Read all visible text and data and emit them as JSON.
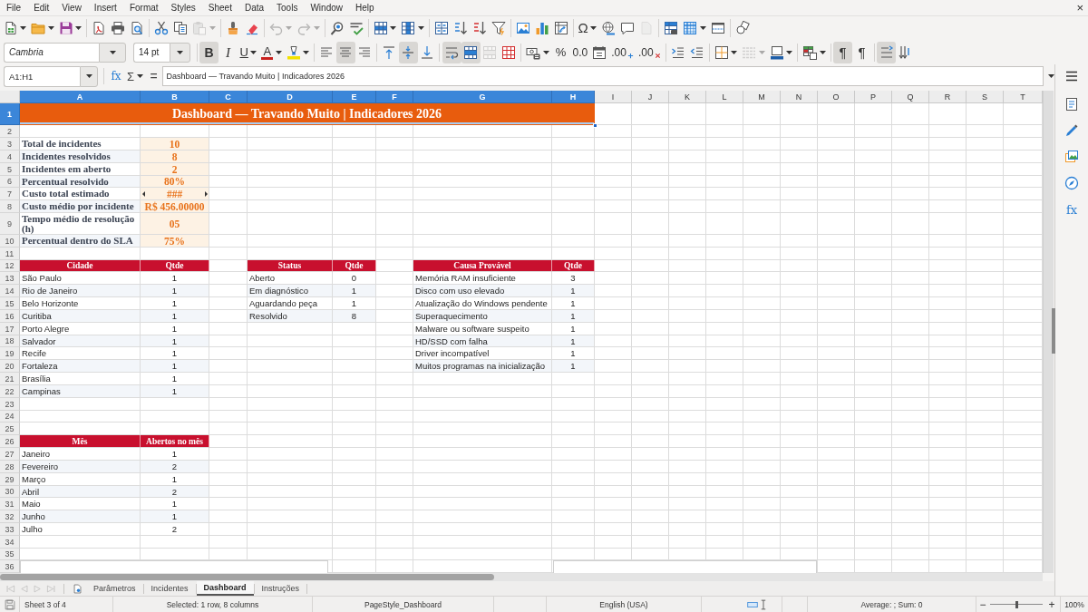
{
  "menu_bar": {
    "items": [
      "File",
      "Edit",
      "View",
      "Insert",
      "Format",
      "Styles",
      "Sheet",
      "Data",
      "Tools",
      "Window",
      "Help"
    ],
    "close_label": "×"
  },
  "standard_toolbar": [
    {
      "disabled": false
    },
    {
      "disabled": false
    },
    {
      "disabled": false
    },
    {
      "disabled": false
    },
    {
      "disabled": false
    },
    {
      "disabled": false
    },
    {
      "disabled": false
    },
    {
      "disabled": false
    },
    {
      "disabled": true
    },
    {
      "disabled": false
    },
    {
      "disabled": false
    },
    {
      "disabled": true
    },
    {
      "disabled": true
    },
    {
      "disabled": false
    },
    {
      "disabled": false
    },
    {
      "disabled": false
    },
    {
      "disabled": false
    },
    {
      "disabled": false
    },
    {
      "disabled": false
    },
    {
      "disabled": false
    },
    {
      "disabled": false
    },
    {
      "disabled": false
    },
    {
      "disabled": false
    },
    {
      "disabled": false
    },
    {
      "label": "Ω",
      "disabled": false
    },
    {
      "disabled": false
    },
    {
      "disabled": false
    },
    {
      "disabled": true
    },
    {
      "disabled": false
    },
    {
      "disabled": false
    },
    {
      "disabled": false
    },
    {
      "disabled": false
    }
  ],
  "formatting_toolbar": {
    "font_name": "Cambria",
    "font_size": "14 pt",
    "buttons": [
      {
        "label": "B",
        "pressed": true,
        "disabled": false
      },
      {
        "label": "I",
        "pressed": false,
        "disabled": false
      },
      {
        "label": "U",
        "pressed": false,
        "disabled": false
      },
      {
        "label": "A",
        "pressed": false,
        "disabled": false
      },
      {
        "pressed": false,
        "disabled": false
      },
      {
        "pressed": false,
        "disabled": false
      },
      {
        "pressed": true,
        "disabled": false
      },
      {
        "pressed": false,
        "disabled": false
      },
      {
        "pressed": false,
        "disabled": false
      },
      {
        "pressed": true,
        "disabled": false
      },
      {
        "pressed": false,
        "disabled": false
      },
      {
        "pressed": true,
        "disabled": false
      },
      {
        "pressed": true,
        "disabled": false
      },
      {
        "pressed": false,
        "disabled": true
      },
      {
        "pressed": false,
        "disabled": false
      },
      {
        "pressed": false,
        "disabled": false
      },
      {
        "label": "%",
        "pressed": false,
        "disabled": false
      },
      {
        "label": "0.0",
        "pressed": false,
        "disabled": false
      },
      {
        "pressed": false,
        "disabled": false
      },
      {
        "label": ".00",
        "pressed": false,
        "disabled": false
      },
      {
        "label": ".00",
        "pressed": false,
        "disabled": false
      },
      {
        "pressed": false,
        "disabled": false
      },
      {
        "pressed": false,
        "disabled": false
      },
      {
        "pressed": false,
        "disabled": false
      },
      {
        "pressed": false,
        "disabled": true
      },
      {
        "pressed": false,
        "disabled": false
      },
      {
        "pressed": false,
        "disabled": false
      },
      {
        "label": "¶",
        "pressed": true,
        "disabled": false
      },
      {
        "label": "¶",
        "pressed": false,
        "disabled": false
      },
      {
        "pressed": true,
        "disabled": false
      },
      {
        "pressed": false,
        "disabled": false
      }
    ]
  },
  "formula_bar": {
    "name_box": "A1:H1",
    "function_wizard": "fx",
    "sum": "Σ",
    "equals": "=",
    "content": "Dashboard — Travando Muito | Indicadores 2026"
  },
  "sheet": {
    "columns": [
      {
        "label": "A",
        "selected": true
      },
      {
        "label": "B",
        "selected": true
      },
      {
        "label": "C",
        "selected": true
      },
      {
        "label": "D",
        "selected": true
      },
      {
        "label": "E",
        "selected": true
      },
      {
        "label": "F",
        "selected": true
      },
      {
        "label": "G",
        "selected": true
      },
      {
        "label": "H",
        "selected": true
      },
      {
        "label": "I",
        "selected": false
      },
      {
        "label": "J",
        "selected": false
      },
      {
        "label": "K",
        "selected": false
      },
      {
        "label": "L",
        "selected": false
      },
      {
        "label": "M",
        "selected": false
      },
      {
        "label": "N",
        "selected": false
      },
      {
        "label": "O",
        "selected": false
      },
      {
        "label": "P",
        "selected": false
      },
      {
        "label": "Q",
        "selected": false
      },
      {
        "label": "R",
        "selected": false
      },
      {
        "label": "S",
        "selected": false
      },
      {
        "label": "T",
        "selected": false
      }
    ],
    "rows": [
      {
        "label": "1",
        "selected": true
      },
      {
        "label": "2",
        "selected": false
      },
      {
        "label": "3",
        "selected": false
      },
      {
        "label": "4",
        "selected": false
      },
      {
        "label": "5",
        "selected": false
      },
      {
        "label": "6",
        "selected": false
      },
      {
        "label": "7",
        "selected": false
      },
      {
        "label": "8",
        "selected": false
      },
      {
        "label": "9",
        "selected": false
      },
      {
        "label": "10",
        "selected": false
      },
      {
        "label": "11",
        "selected": false
      },
      {
        "label": "12",
        "selected": false
      },
      {
        "label": "13",
        "selected": false
      },
      {
        "label": "14",
        "selected": false
      },
      {
        "label": "15",
        "selected": false
      },
      {
        "label": "16",
        "selected": false
      },
      {
        "label": "17",
        "selected": false
      },
      {
        "label": "18",
        "selected": false
      },
      {
        "label": "19",
        "selected": false
      },
      {
        "label": "20",
        "selected": false
      },
      {
        "label": "21",
        "selected": false
      },
      {
        "label": "22",
        "selected": false
      },
      {
        "label": "23",
        "selected": false
      },
      {
        "label": "24",
        "selected": false
      },
      {
        "label": "25",
        "selected": false
      },
      {
        "label": "26",
        "selected": false
      },
      {
        "label": "27",
        "selected": false
      },
      {
        "label": "28",
        "selected": false
      },
      {
        "label": "29",
        "selected": false
      },
      {
        "label": "30",
        "selected": false
      },
      {
        "label": "31",
        "selected": false
      },
      {
        "label": "32",
        "selected": false
      },
      {
        "label": "33",
        "selected": false
      },
      {
        "label": "34",
        "selected": false
      },
      {
        "label": "35",
        "selected": false
      },
      {
        "label": "36",
        "selected": false
      }
    ],
    "title": {
      "text": "Dashboard — Travando Muito | Indicadores 2026",
      "selected": true
    },
    "kpis": [
      {
        "label": "Total de incidentes",
        "value": "10",
        "clipped": false
      },
      {
        "label": "Incidentes resolvidos",
        "value": "8",
        "clipped": false
      },
      {
        "label": "Incidentes em aberto",
        "value": "2",
        "clipped": false
      },
      {
        "label": "Percentual resolvido",
        "value": "80%",
        "clipped": false
      },
      {
        "label": "Custo total estimado",
        "value": "###",
        "clipped": true
      },
      {
        "label": "Custo médio por incidente",
        "value": "R$ 456.00000",
        "clipped": false
      },
      {
        "label": "Tempo médio de resolução (h)",
        "value": "05",
        "clipped": false
      },
      {
        "label": "Percentual dentro do SLA",
        "value": "75%",
        "clipped": false
      }
    ],
    "tables": [
      {
        "columns": [
          "Cidade",
          "Qtde"
        ],
        "rows": [
          [
            "São Paulo",
            "1"
          ],
          [
            "Rio de Janeiro",
            "1"
          ],
          [
            "Belo Horizonte",
            "1"
          ],
          [
            "Curitiba",
            "1"
          ],
          [
            "Porto Alegre",
            "1"
          ],
          [
            "Salvador",
            "1"
          ],
          [
            "Recife",
            "1"
          ],
          [
            "Fortaleza",
            "1"
          ],
          [
            "Brasília",
            "1"
          ],
          [
            "Campinas",
            "1"
          ]
        ]
      },
      {
        "columns": [
          "Status",
          "Qtde"
        ],
        "rows": [
          [
            "Aberto",
            "0"
          ],
          [
            "Em diagnóstico",
            "1"
          ],
          [
            "Aguardando peça",
            "1"
          ],
          [
            "Resolvido",
            "8"
          ]
        ]
      },
      {
        "columns": [
          "Causa Provável",
          "Qtde"
        ],
        "rows": [
          [
            "Memória RAM insuficiente",
            "3"
          ],
          [
            "Disco com uso elevado",
            "1"
          ],
          [
            "Atualização do Windows pendente",
            "1"
          ],
          [
            "Superaquecimento",
            "1"
          ],
          [
            "Malware ou software suspeito",
            "1"
          ],
          [
            "HD/SSD com falha",
            "1"
          ],
          [
            "Driver incompatível",
            "1"
          ],
          [
            "Muitos programas na inicialização",
            "1"
          ]
        ]
      },
      {
        "columns": [
          "Mês",
          "Abertos no mês"
        ],
        "rows": [
          [
            "Janeiro",
            "1"
          ],
          [
            "Fevereiro",
            "2"
          ],
          [
            "Março",
            "1"
          ],
          [
            "Abril",
            "2"
          ],
          [
            "Maio",
            "1"
          ],
          [
            "Junho",
            "1"
          ],
          [
            "Julho",
            "2"
          ]
        ]
      }
    ]
  },
  "sheet_tabs": {
    "navigation": [
      {
        "disabled": true
      },
      {
        "disabled": true
      },
      {
        "disabled": true
      },
      {
        "disabled": true
      }
    ],
    "tabs": [
      {
        "label": "Parâmetros",
        "selected": false
      },
      {
        "label": "Incidentes",
        "selected": false
      },
      {
        "label": "Dashboard",
        "selected": true
      },
      {
        "label": "Instruções",
        "selected": false
      }
    ]
  },
  "sidebar": {
    "functions_label": "fx"
  },
  "status_bar": {
    "sheet_position": "Sheet 3 of 4",
    "selection": "Selected: 1 row, 8 columns",
    "page_style": "PageStyle_Dashboard",
    "language": "English (USA)",
    "summary": "Average: ; Sum: 0",
    "zoom_out": "−",
    "zoom_slider": {
      "level": 0.5
    },
    "zoom_in": "+",
    "zoom": "100%"
  }
}
